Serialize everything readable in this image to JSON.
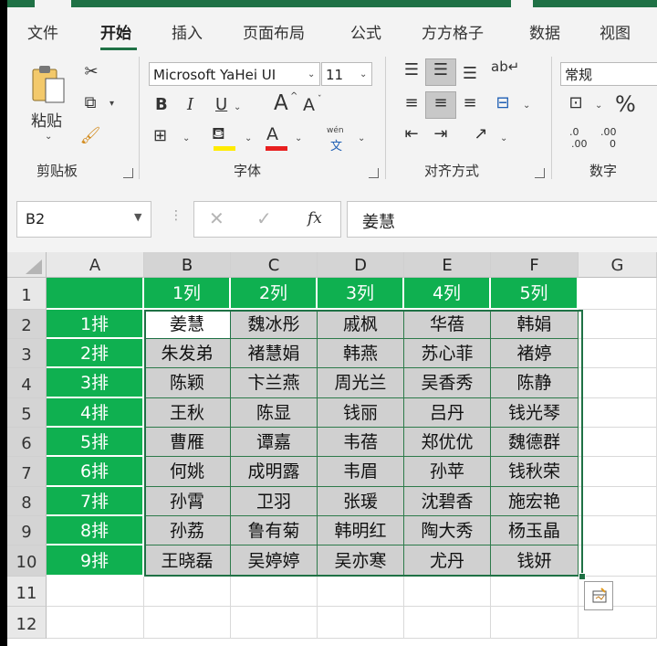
{
  "tabs": [
    "文件",
    "开始",
    "插入",
    "页面布局",
    "公式",
    "方方格子",
    "数据",
    "视图"
  ],
  "active_tab": "开始",
  "ribbon": {
    "clipboard": {
      "paste_label": "粘贴",
      "group_label": "剪贴板"
    },
    "font": {
      "font_name": "Microsoft YaHei UI",
      "font_size": "11",
      "bold": "B",
      "italic": "I",
      "underline": "U",
      "grow": "A",
      "shrink": "A",
      "font_color_glyph": "A",
      "phonetic_top": "wén",
      "phonetic_bottom": "文",
      "group_label": "字体"
    },
    "alignment": {
      "group_label": "对齐方式"
    },
    "number": {
      "format": "常规",
      "percent": "%",
      "inc_decimal_top": ".0",
      "inc_decimal_bottom": ".00",
      "dec_decimal_top": ".00",
      "dec_decimal_bottom": "0",
      "group_label": "数字"
    }
  },
  "formula_bar": {
    "name_box": "B2",
    "fx": "fx",
    "formula": "姜慧"
  },
  "sheet": {
    "columns": [
      "A",
      "B",
      "C",
      "D",
      "E",
      "F",
      "G"
    ],
    "rows": [
      "1",
      "2",
      "3",
      "4",
      "5",
      "6",
      "7",
      "8",
      "9",
      "10",
      "11",
      "12"
    ],
    "selected_cell": "B2",
    "header_row": [
      "",
      "1列",
      "2列",
      "3列",
      "4列",
      "5列"
    ],
    "row_labels": [
      "1排",
      "2排",
      "3排",
      "4排",
      "5排",
      "6排",
      "7排",
      "8排",
      "9排"
    ],
    "data": [
      [
        "姜慧",
        "魏冰彤",
        "戚枫",
        "华蓓",
        "韩娟"
      ],
      [
        "朱发弟",
        "褚慧娟",
        "韩燕",
        "苏心菲",
        "褚婷"
      ],
      [
        "陈颖",
        "卞兰燕",
        "周光兰",
        "吴香秀",
        "陈静"
      ],
      [
        "王秋",
        "陈显",
        "钱丽",
        "吕丹",
        "钱光琴"
      ],
      [
        "曹雁",
        "谭嘉",
        "韦蓓",
        "郑优优",
        "魏德群"
      ],
      [
        "何姚",
        "成明露",
        "韦眉",
        "孙苹",
        "钱秋荣"
      ],
      [
        "孙霄",
        "卫羽",
        "张瑗",
        "沈碧香",
        "施宏艳"
      ],
      [
        "孙荔",
        "鲁有菊",
        "韩明红",
        "陶大秀",
        "杨玉晶"
      ],
      [
        "王晓磊",
        "吴婷婷",
        "吴亦寒",
        "尤丹",
        "钱妍"
      ]
    ]
  },
  "colors": {
    "green": "#0fb050",
    "data_fill": "#d0d0d0",
    "accent": "#1f7145"
  }
}
